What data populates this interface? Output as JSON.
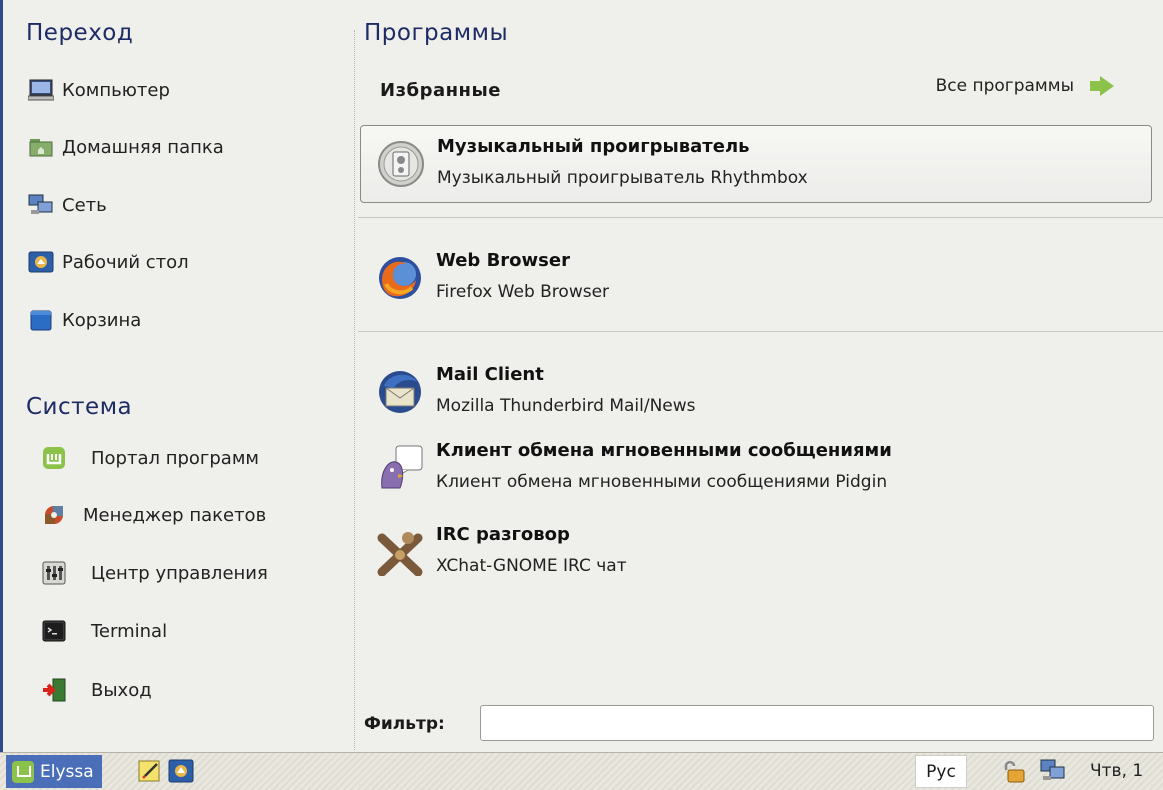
{
  "places": {
    "title": "Переход",
    "items": [
      {
        "label": "Компьютер",
        "icon": "computer-icon"
      },
      {
        "label": "Домашняя папка",
        "icon": "home-folder-icon"
      },
      {
        "label": "Сеть",
        "icon": "network-icon"
      },
      {
        "label": "Рабочий стол",
        "icon": "desktop-icon"
      },
      {
        "label": "Корзина",
        "icon": "trash-icon"
      }
    ]
  },
  "system": {
    "title": "Система",
    "items": [
      {
        "label": "Портал программ",
        "icon": "software-portal-icon"
      },
      {
        "label": "Менеджер пакетов",
        "icon": "package-manager-icon"
      },
      {
        "label": "Центр управления",
        "icon": "control-center-icon"
      },
      {
        "label": "Terminal",
        "icon": "terminal-icon"
      },
      {
        "label": "Выход",
        "icon": "logout-icon"
      }
    ]
  },
  "programs": {
    "title": "Программы",
    "favorites_label": "Избранные",
    "all_programs_label": "Все программы",
    "apps": [
      {
        "name": "Музыкальный проигрыватель",
        "description": "Музыкальный проигрыватель Rhythmbox",
        "icon": "music-player-icon"
      },
      {
        "name": "Web Browser",
        "description": "Firefox Web Browser",
        "icon": "firefox-icon"
      },
      {
        "name": "Mail Client",
        "description": "Mozilla Thunderbird Mail/News",
        "icon": "thunderbird-icon"
      },
      {
        "name": "Клиент обмена мгновенными сообщениями",
        "description": "Клиент обмена мгновенными сообщениями Pidgin",
        "icon": "pidgin-icon"
      },
      {
        "name": "IRC разговор",
        "description": "XChat-GNOME IRC чат",
        "icon": "xchat-icon"
      }
    ],
    "filter_label": "Фильтр:",
    "filter_value": ""
  },
  "taskbar": {
    "start_label": "Elyssa",
    "language": "Рус",
    "clock": "Чтв, 1"
  },
  "colors": {
    "accent": "#2f4a8a",
    "section_title": "#1e2c66",
    "start_button": "#4a6eb8",
    "mint_green": "#8bc34a"
  }
}
